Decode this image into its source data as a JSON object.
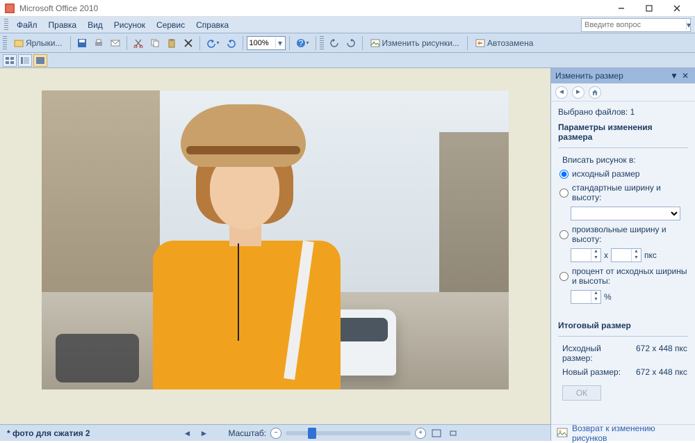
{
  "title": "Microsoft Office 2010",
  "help_placeholder": "Введите вопрос",
  "menus": {
    "file": "Файл",
    "edit": "Правка",
    "view": "Вид",
    "picture": "Рисунок",
    "service": "Сервис",
    "help": "Справка"
  },
  "toolbar": {
    "shortcuts": "Ярлыки...",
    "zoom": "100%",
    "edit_pictures": "Изменить рисунки...",
    "autoreplace": "Автозамена"
  },
  "status": {
    "filename": "* фото для сжатия 2",
    "zoom_label": "Масштаб:"
  },
  "panel": {
    "title": "Изменить размер",
    "selected_files": "Выбрано файлов: 1",
    "resize_params": "Параметры изменения размера",
    "fit_label": "Вписать рисунок в:",
    "opt_original": "исходный размер",
    "opt_standard": "стандартные ширину и высоту:",
    "opt_custom": "произвольные ширину и высоту:",
    "opt_percent": "процент от исходных ширины и высоты:",
    "x_sep": "x",
    "px_unit": "пкс",
    "pct_unit": "%",
    "final_size": "Итоговый размер",
    "src_size_k": "Исходный размер:",
    "src_size_v": "672 x 448 пкс",
    "new_size_k": "Новый размер:",
    "new_size_v": "672 x 448 пкс",
    "ok": "ОК",
    "back_link": "Возврат к изменению рисунков"
  }
}
